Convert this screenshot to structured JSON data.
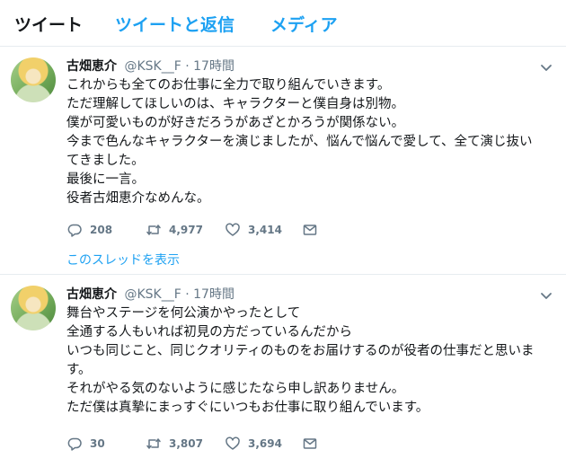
{
  "tabs": [
    {
      "label": "ツイート"
    },
    {
      "label": "ツイートと返信"
    },
    {
      "label": "メディア"
    }
  ],
  "tweets": [
    {
      "name": "古畑恵介",
      "handle": "@KSK__F",
      "dot": "·",
      "time": "17時間",
      "lines": [
        "これからも全てのお仕事に全力で取り組んでいきます。",
        "ただ理解してほしいのは、キャラクターと僕自身は別物。",
        "僕が可愛いものが好きだろうがあざとかろうが関係ない。",
        "今まで色んなキャラクターを演じましたが、悩んで悩んで愛して、全て演じ抜い",
        "てきました。",
        "最後に一言。",
        "役者古畑恵介なめんな。"
      ],
      "replies": "208",
      "retweets": "4,977",
      "likes": "3,414",
      "thread_link": "このスレッドを表示"
    },
    {
      "name": "古畑恵介",
      "handle": "@KSK__F",
      "dot": "·",
      "time": "17時間",
      "lines": [
        "舞台やステージを何公演かやったとして",
        "全通する人もいれば初見の方だっているんだから",
        "いつも同じこと、同じクオリティのものをお届けするのが役者の仕事だと思いま",
        "す。",
        "それがやる気のないように感じたなら申し訳ありません。",
        "ただ僕は真摯にまっすぐにいつもお仕事に取り組んでいます。"
      ],
      "replies": "30",
      "retweets": "3,807",
      "likes": "3,694"
    }
  ],
  "icons": {
    "reply": "reply-icon",
    "retweet": "retweet-icon",
    "like": "heart-icon",
    "dm": "envelope-icon",
    "caret": "chevron-down-icon"
  },
  "colors": {
    "accent": "#1da1f2",
    "text": "#14171a",
    "secondary": "#657786",
    "border": "#e6ecf0"
  }
}
